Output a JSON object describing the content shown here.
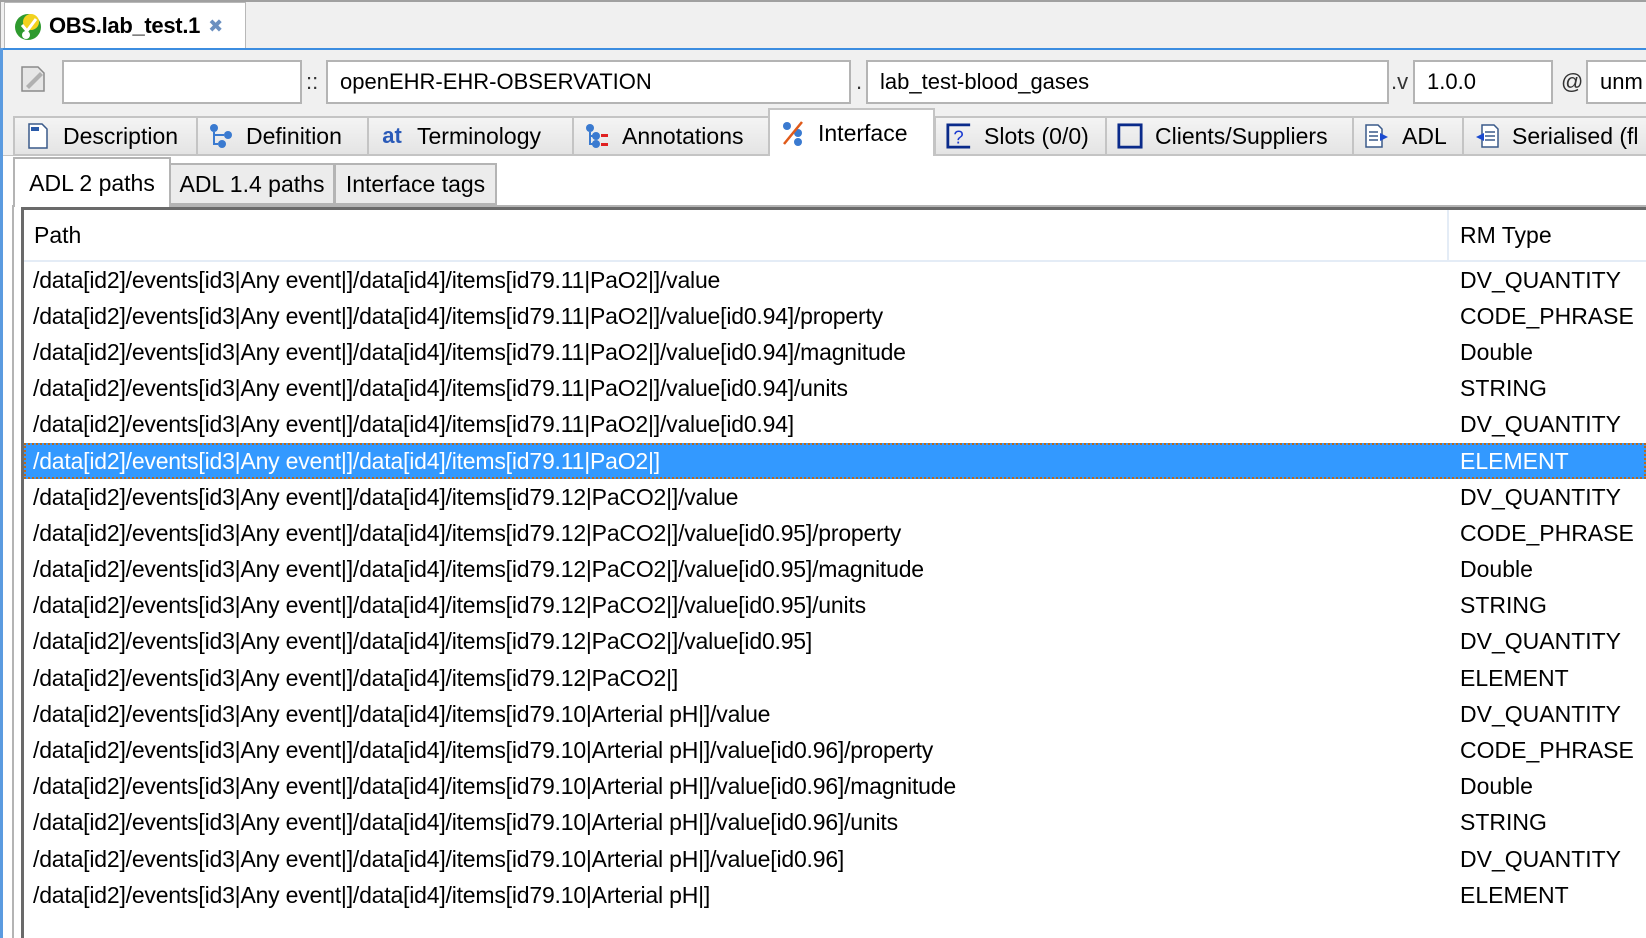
{
  "editor_tab": {
    "title": "OBS.lab_test.1",
    "close_icon": "close-icon"
  },
  "id_fields": {
    "prefix_value": "",
    "sep1": "::",
    "rm_publisher_value": "openEHR-EHR-OBSERVATION",
    "sep2": ".",
    "concept_value": "lab_test-blood_gases",
    "sep3": ".v",
    "version_value": "1.0.0",
    "sep4": "@",
    "lifecycle_value": "unm"
  },
  "main_tabs": [
    {
      "label": "Description",
      "icon": "description-icon",
      "active": false
    },
    {
      "label": "Definition",
      "icon": "definition-tree-icon",
      "active": false
    },
    {
      "label": "Terminology",
      "icon": "terminology-at-icon",
      "active": false
    },
    {
      "label": "Annotations",
      "icon": "annotations-icon",
      "active": false
    },
    {
      "label": "Interface",
      "icon": "interface-icon",
      "active": true
    },
    {
      "label": "Slots (0/0)",
      "icon": "slots-question-icon",
      "active": false
    },
    {
      "label": "Clients/Suppliers",
      "icon": "clients-suppliers-icon",
      "active": false
    },
    {
      "label": "ADL",
      "icon": "adl-export-icon",
      "active": false
    },
    {
      "label": "Serialised (fl",
      "icon": "serialised-import-icon",
      "active": false
    }
  ],
  "sub_tabs": [
    {
      "label": "ADL 2 paths",
      "active": true
    },
    {
      "label": "ADL 1.4 paths",
      "active": false
    },
    {
      "label": "Interface tags",
      "active": false
    }
  ],
  "table": {
    "columns": [
      "Path",
      "RM Type"
    ],
    "selected_index": 5,
    "rows": [
      {
        "path": "/data[id2]/events[id3|Any event|]/data[id4]/items[id79.11|PaO2|]/value",
        "type": "DV_QUANTITY"
      },
      {
        "path": "/data[id2]/events[id3|Any event|]/data[id4]/items[id79.11|PaO2|]/value[id0.94]/property",
        "type": "CODE_PHRASE"
      },
      {
        "path": "/data[id2]/events[id3|Any event|]/data[id4]/items[id79.11|PaO2|]/value[id0.94]/magnitude",
        "type": "Double"
      },
      {
        "path": "/data[id2]/events[id3|Any event|]/data[id4]/items[id79.11|PaO2|]/value[id0.94]/units",
        "type": "STRING"
      },
      {
        "path": "/data[id2]/events[id3|Any event|]/data[id4]/items[id79.11|PaO2|]/value[id0.94]",
        "type": "DV_QUANTITY"
      },
      {
        "path": "/data[id2]/events[id3|Any event|]/data[id4]/items[id79.11|PaO2|]",
        "type": "ELEMENT"
      },
      {
        "path": "/data[id2]/events[id3|Any event|]/data[id4]/items[id79.12|PaCO2|]/value",
        "type": "DV_QUANTITY"
      },
      {
        "path": "/data[id2]/events[id3|Any event|]/data[id4]/items[id79.12|PaCO2|]/value[id0.95]/property",
        "type": "CODE_PHRASE"
      },
      {
        "path": "/data[id2]/events[id3|Any event|]/data[id4]/items[id79.12|PaCO2|]/value[id0.95]/magnitude",
        "type": "Double"
      },
      {
        "path": "/data[id2]/events[id3|Any event|]/data[id4]/items[id79.12|PaCO2|]/value[id0.95]/units",
        "type": "STRING"
      },
      {
        "path": "/data[id2]/events[id3|Any event|]/data[id4]/items[id79.12|PaCO2|]/value[id0.95]",
        "type": "DV_QUANTITY"
      },
      {
        "path": "/data[id2]/events[id3|Any event|]/data[id4]/items[id79.12|PaCO2|]",
        "type": "ELEMENT"
      },
      {
        "path": "/data[id2]/events[id3|Any event|]/data[id4]/items[id79.10|Arterial pH|]/value",
        "type": "DV_QUANTITY"
      },
      {
        "path": "/data[id2]/events[id3|Any event|]/data[id4]/items[id79.10|Arterial pH|]/value[id0.96]/property",
        "type": "CODE_PHRASE"
      },
      {
        "path": "/data[id2]/events[id3|Any event|]/data[id4]/items[id79.10|Arterial pH|]/value[id0.96]/magnitude",
        "type": "Double"
      },
      {
        "path": "/data[id2]/events[id3|Any event|]/data[id4]/items[id79.10|Arterial pH|]/value[id0.96]/units",
        "type": "STRING"
      },
      {
        "path": "/data[id2]/events[id3|Any event|]/data[id4]/items[id79.10|Arterial pH|]/value[id0.96]",
        "type": "DV_QUANTITY"
      },
      {
        "path": "/data[id2]/events[id3|Any event|]/data[id4]/items[id79.10|Arterial pH|]",
        "type": "ELEMENT"
      }
    ]
  },
  "colors": {
    "selection": "#3399ff",
    "accent_line": "#3c8de0"
  }
}
